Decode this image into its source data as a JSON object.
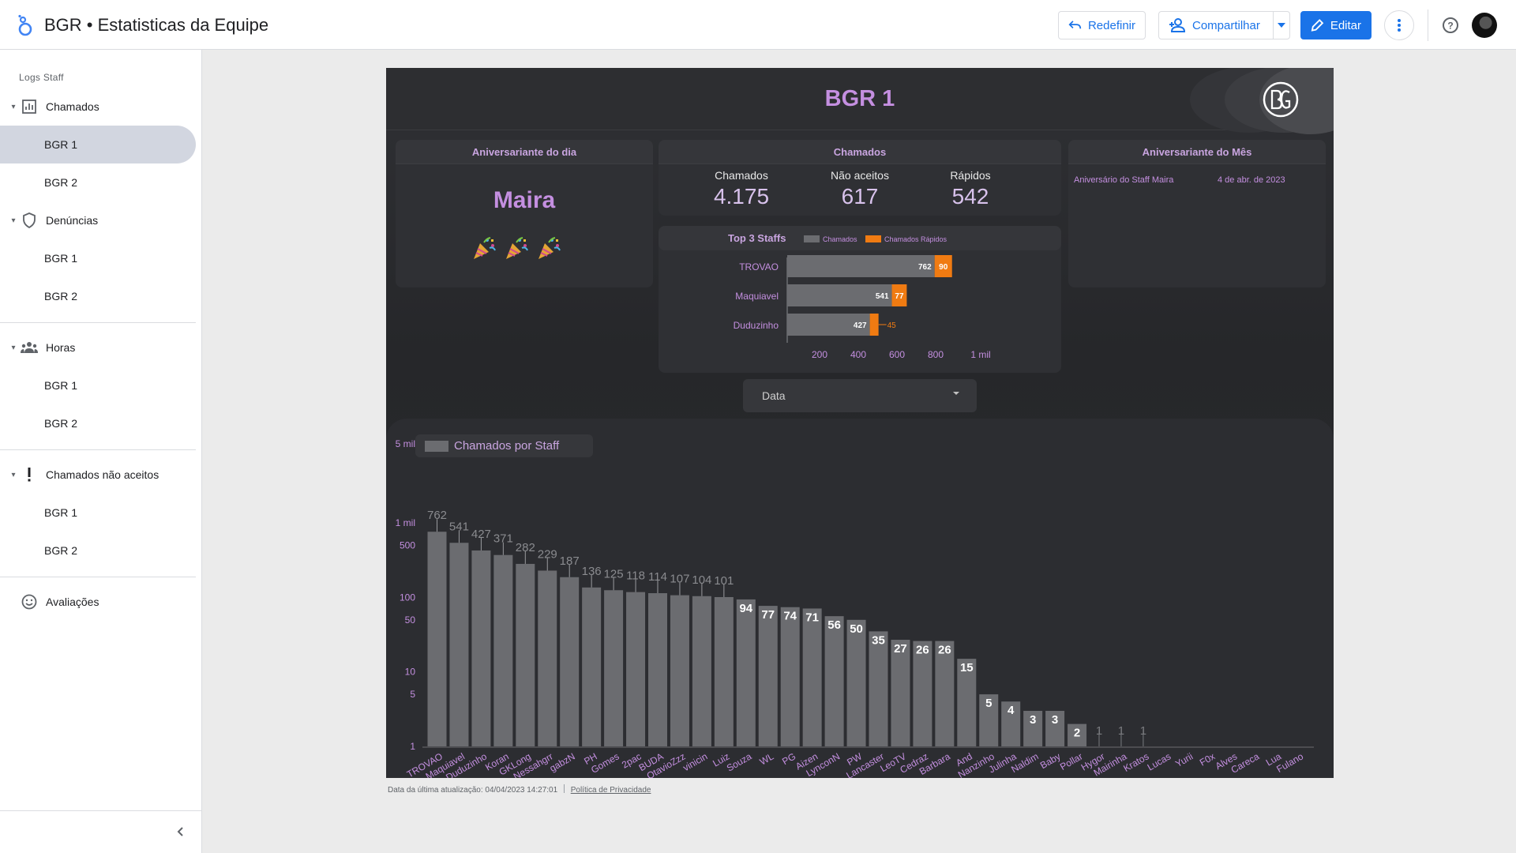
{
  "app": {
    "title": "BGR • Estatisticas da Equipe"
  },
  "toolbar": {
    "reset_label": "Redefinir",
    "share_label": "Compartilhar",
    "edit_label": "Editar"
  },
  "sidebar": {
    "section_label": "Logs Staff",
    "groups": [
      {
        "label": "Chamados",
        "icon": "bar-chart-icon",
        "items": [
          "BGR 1",
          "BGR 2"
        ]
      },
      {
        "label": "Denúncias",
        "icon": "shield-icon",
        "items": [
          "BGR 1",
          "BGR 2"
        ]
      },
      {
        "label": "Horas",
        "icon": "group-icon",
        "items": [
          "BGR 1",
          "BGR 2"
        ]
      },
      {
        "label": "Chamados não aceitos",
        "icon": "exclamation-icon",
        "items": [
          "BGR 1",
          "BGR 2"
        ]
      }
    ],
    "standalone": {
      "label": "Avaliações",
      "icon": "smiley-icon"
    },
    "active_item": "Chamados / BGR 1"
  },
  "report": {
    "title": "BGR 1",
    "birthday_day": {
      "header": "Aniversariante do dia",
      "name": "Maira",
      "icons": [
        "party-popper-icon",
        "party-popper-icon",
        "party-popper-icon"
      ]
    },
    "summary": {
      "header": "Chamados",
      "kpis": [
        {
          "label": "Chamados",
          "value": "4.175"
        },
        {
          "label": "Não aceitos",
          "value": "617"
        },
        {
          "label": "Rápidos",
          "value": "542"
        }
      ]
    },
    "birthday_month": {
      "header": "Aniversariante do Mês",
      "row": {
        "description": "Aniversário do Staff Maira",
        "date": "4 de abr. de 2023"
      }
    },
    "filter": {
      "label": "Data"
    },
    "footer": {
      "updated": "Data da última atualização: 04/04/2023 14:27:01",
      "policy": "Política de Privacidade"
    }
  },
  "colors": {
    "accent_purple": "#c48fe0",
    "bar_gray": "#6b6c70",
    "bar_orange": "#f07b12",
    "brand_blue": "#1a73e8"
  },
  "chart_data": [
    {
      "type": "bar",
      "orientation": "horizontal",
      "stacked": true,
      "title": "Top 3 Staffs",
      "categories": [
        "TROVAO",
        "Maquiavel",
        "Duduzinho"
      ],
      "series": [
        {
          "name": "Chamados",
          "values": [
            762,
            541,
            427
          ]
        },
        {
          "name": "Chamados Rápidos",
          "values": [
            90,
            77,
            45
          ]
        }
      ],
      "x_ticks": [
        "200",
        "400",
        "600",
        "800",
        "1 mil"
      ],
      "xlim": [
        0,
        1000
      ],
      "legend": "top"
    },
    {
      "type": "bar",
      "title": "",
      "y_scale": "log",
      "ylim": [
        1,
        5000
      ],
      "y_ticks": [
        "1",
        "5",
        "10",
        "50",
        "100",
        "500",
        "1 mil",
        "5 mil"
      ],
      "legend": "top-left",
      "categories": [
        "TROVAO",
        "Maquiavel",
        "Duduzinho",
        "Koran",
        "GKLong",
        "Nessahgrr",
        "gabzN",
        "PH",
        "Gomes",
        "2pac",
        "BUDA",
        "OtavioZzz",
        "vinicin",
        "Luiz",
        "Souza",
        "WL",
        "PG",
        "Aizen",
        "LynconN",
        "PW",
        "Lancaster",
        "LeoTV",
        "Cedraz",
        "Barbara",
        "And",
        "Nanzinho",
        "Julinha",
        "Naldim",
        "Baby",
        "Pollar",
        "Hygor",
        "Mairinha",
        "Kratos",
        "Lucas",
        "Yurii",
        "F0x",
        "Alves",
        "Careca",
        "Lua",
        "Fulano"
      ],
      "series": [
        {
          "name": "Chamados por Staff",
          "values": [
            762,
            541,
            427,
            371,
            282,
            229,
            187,
            136,
            125,
            118,
            114,
            107,
            104,
            101,
            94,
            77,
            74,
            71,
            56,
            50,
            35,
            27,
            26,
            26,
            15,
            5,
            4,
            3,
            3,
            2,
            1,
            1,
            1,
            null,
            null,
            null,
            null,
            null,
            null,
            null
          ]
        }
      ]
    }
  ]
}
